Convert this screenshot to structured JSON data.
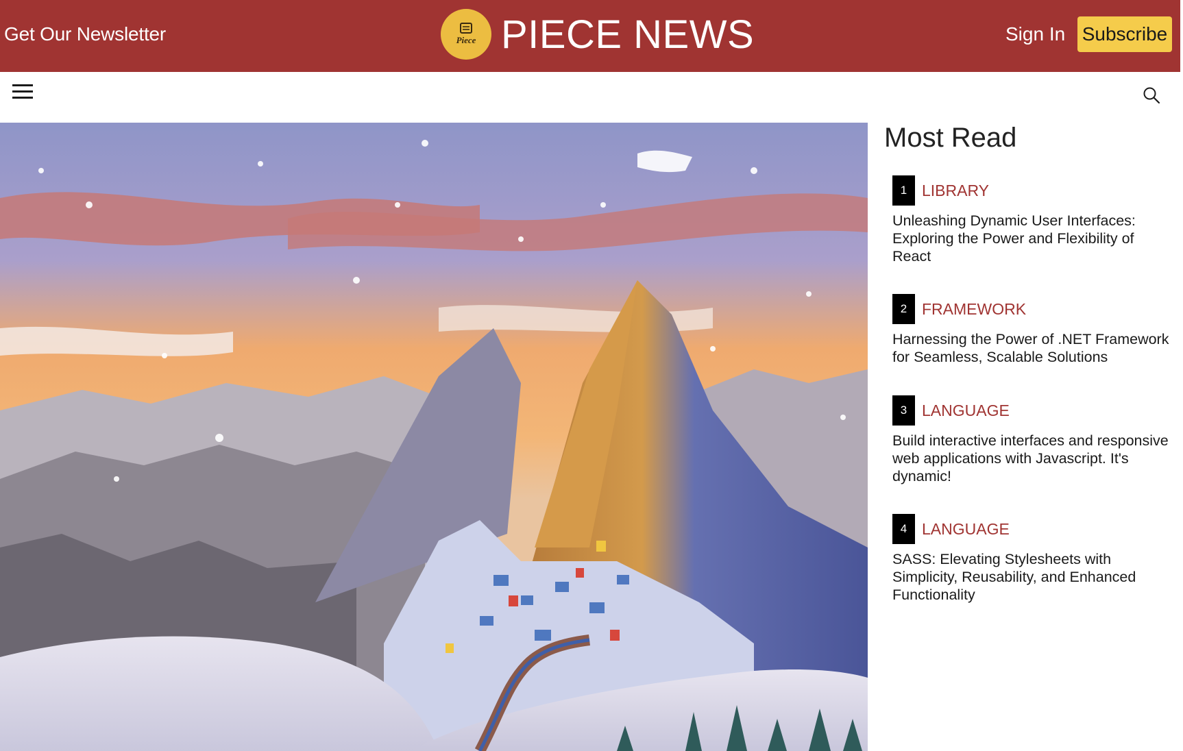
{
  "header": {
    "newsletter_link": "Get Our Newsletter",
    "brand": "PIECE NEWS",
    "logo_text": "Piece",
    "sign_in": "Sign In",
    "subscribe": "Subscribe"
  },
  "nav": {
    "menu_icon": "hamburger-menu-icon",
    "search_icon": "search-icon"
  },
  "hero": {
    "image_subject": "painted snowy mountain village at sunset"
  },
  "most_read": {
    "title": "Most Read",
    "items": [
      {
        "rank": "1",
        "category": "LIBRARY",
        "title": "Unleashing Dynamic User Interfaces: Exploring the Power and Flexibility of React"
      },
      {
        "rank": "2",
        "category": "FRAMEWORK",
        "title": "Harnessing the Power of .NET Framework for Seamless, Scalable Solutions"
      },
      {
        "rank": "3",
        "category": "LANGUAGE",
        "title": "Build interactive interfaces and responsive web applications with Javascript. It's dynamic!"
      },
      {
        "rank": "4",
        "category": "LANGUAGE",
        "title": "SASS: Elevating Stylesheets with Simplicity, Reusability, and Enhanced Functionality"
      }
    ]
  },
  "colors": {
    "brand_red": "#a03432",
    "subscribe_yellow": "#f5cc4b",
    "logo_gold": "#ecbd41",
    "rank_black": "#000000"
  }
}
